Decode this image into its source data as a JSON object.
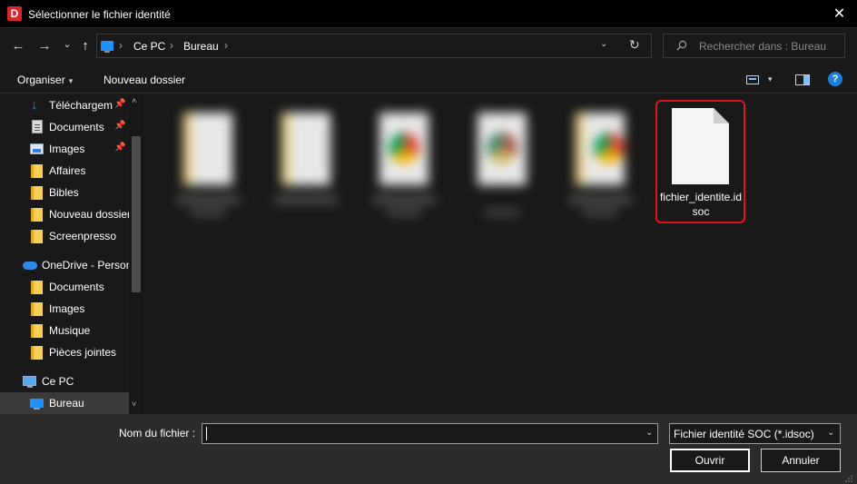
{
  "window": {
    "app_icon_letter": "D",
    "title": "Sélectionner le fichier identité",
    "close_glyph": "✕"
  },
  "navigation": {
    "back_glyph": "←",
    "forward_glyph": "→",
    "recent_glyph": "⌄",
    "up_glyph": "↑",
    "breadcrumb": [
      "Ce PC",
      "Bureau"
    ],
    "separator": "›",
    "dropdown_glyph": "⌄",
    "refresh_glyph": "↻"
  },
  "search": {
    "placeholder": "Rechercher dans : Bureau"
  },
  "toolbar": {
    "organize_label": "Organiser",
    "organize_caret": "▾",
    "new_folder_label": "Nouveau dossier",
    "view_caret": "▾",
    "help_glyph": "?"
  },
  "sidebar": {
    "pin_glyph": "📌",
    "items": [
      {
        "label": "Téléchargements",
        "pinned": true
      },
      {
        "label": "Documents",
        "pinned": true
      },
      {
        "label": "Images",
        "pinned": true
      },
      {
        "label": "Affaires"
      },
      {
        "label": "Bibles"
      },
      {
        "label": "Nouveau dossier"
      },
      {
        "label": "Screenpresso"
      },
      {
        "label": "OneDrive - Personal"
      },
      {
        "label": "Documents"
      },
      {
        "label": "Images"
      },
      {
        "label": "Musique"
      },
      {
        "label": "Pièces jointes"
      },
      {
        "label": "Ce PC"
      },
      {
        "label": "Bureau",
        "selected": true
      }
    ],
    "scroll_up_glyph": "˄",
    "scroll_down_glyph": "˅"
  },
  "files": {
    "selected": {
      "name": "fichier_identite.idsoc",
      "highlight_color": "#e0131a"
    }
  },
  "footer": {
    "filename_label": "Nom du fichier :",
    "filename_value": "",
    "filename_drop_glyph": "⌄",
    "filetype_value": "Fichier identité SOC (*.idsoc)",
    "filetype_drop_glyph": "⌄",
    "open_label": "Ouvrir",
    "cancel_label": "Annuler"
  },
  "colors": {
    "accent": "#1e90ff",
    "danger": "#e0131a",
    "background": "#191919"
  }
}
